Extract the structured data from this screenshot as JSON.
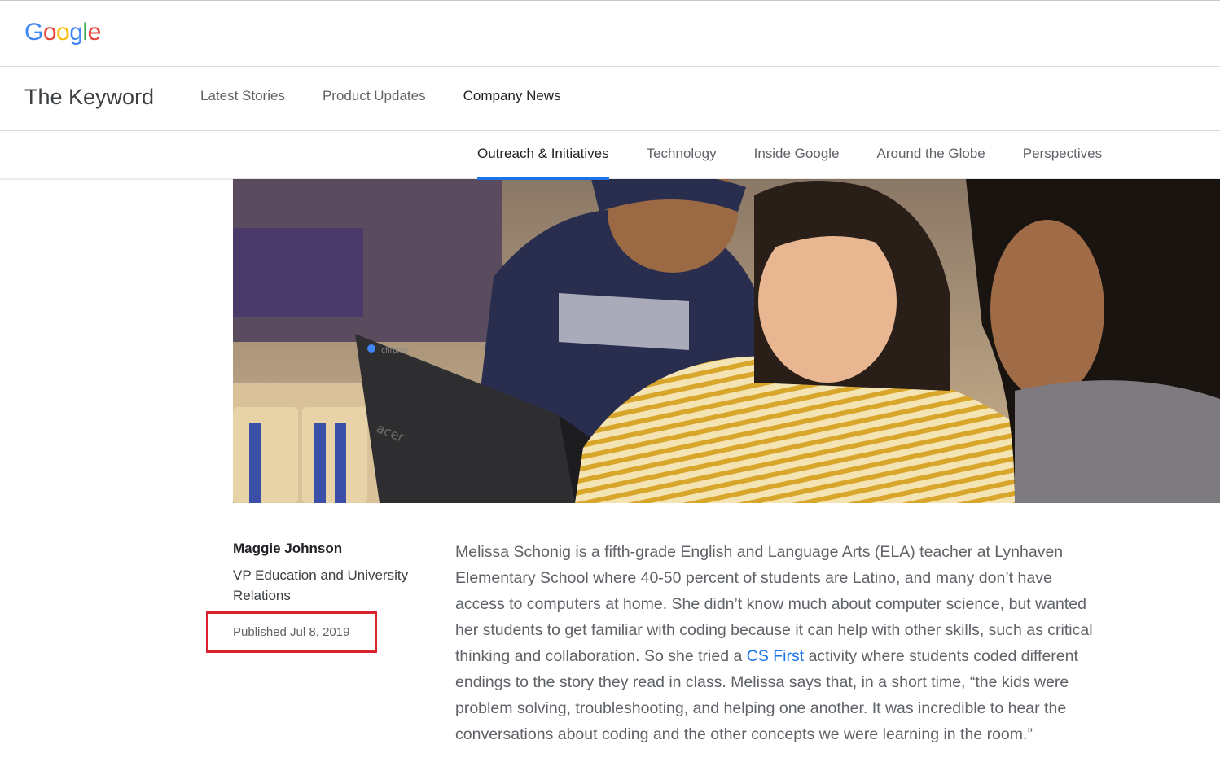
{
  "logo": {
    "text": "Google",
    "letters": [
      {
        "ch": "G",
        "color": "#4285F4"
      },
      {
        "ch": "o",
        "color": "#EA4335"
      },
      {
        "ch": "o",
        "color": "#FBBC05"
      },
      {
        "ch": "g",
        "color": "#4285F4"
      },
      {
        "ch": "l",
        "color": "#34A853"
      },
      {
        "ch": "e",
        "color": "#EA4335"
      }
    ]
  },
  "header": {
    "site_title": "The Keyword",
    "nav": [
      "Latest Stories",
      "Product Updates",
      "Company News"
    ],
    "active_nav": "Company News"
  },
  "subnav": {
    "items": [
      "Outreach & Initiatives",
      "Technology",
      "Inside Google",
      "Around the Globe",
      "Perspectives"
    ],
    "active": "Outreach & Initiatives",
    "accent": "#1a73e8"
  },
  "article": {
    "author_name": "Maggie Johnson",
    "author_role": "VP Education and University Relations",
    "published": "Published Jul 8, 2019",
    "highlight_color": "#d9232d",
    "body_before": "Melissa Schonig is a fifth-grade English and Language Arts (ELA) teacher at Lynhaven Elementary School where 40-50 percent of students are Latino, and many don’t have access to computers at home. She didn’t know much about computer science, but wanted her students to get familiar with coding because it can help with other skills, such as critical thinking and collaboration. So she tried a ",
    "body_link": "CS First",
    "body_after": " activity where students coded different endings to the story they read in class. Melissa says that, in a short time, “the kids were problem solving, troubleshooting, and helping one another. It was incredible to hear the conversations about coding and the other concepts we were learning in the room.”",
    "hero_laptop_brand": "acer",
    "hero_laptop_os": "chrome"
  }
}
